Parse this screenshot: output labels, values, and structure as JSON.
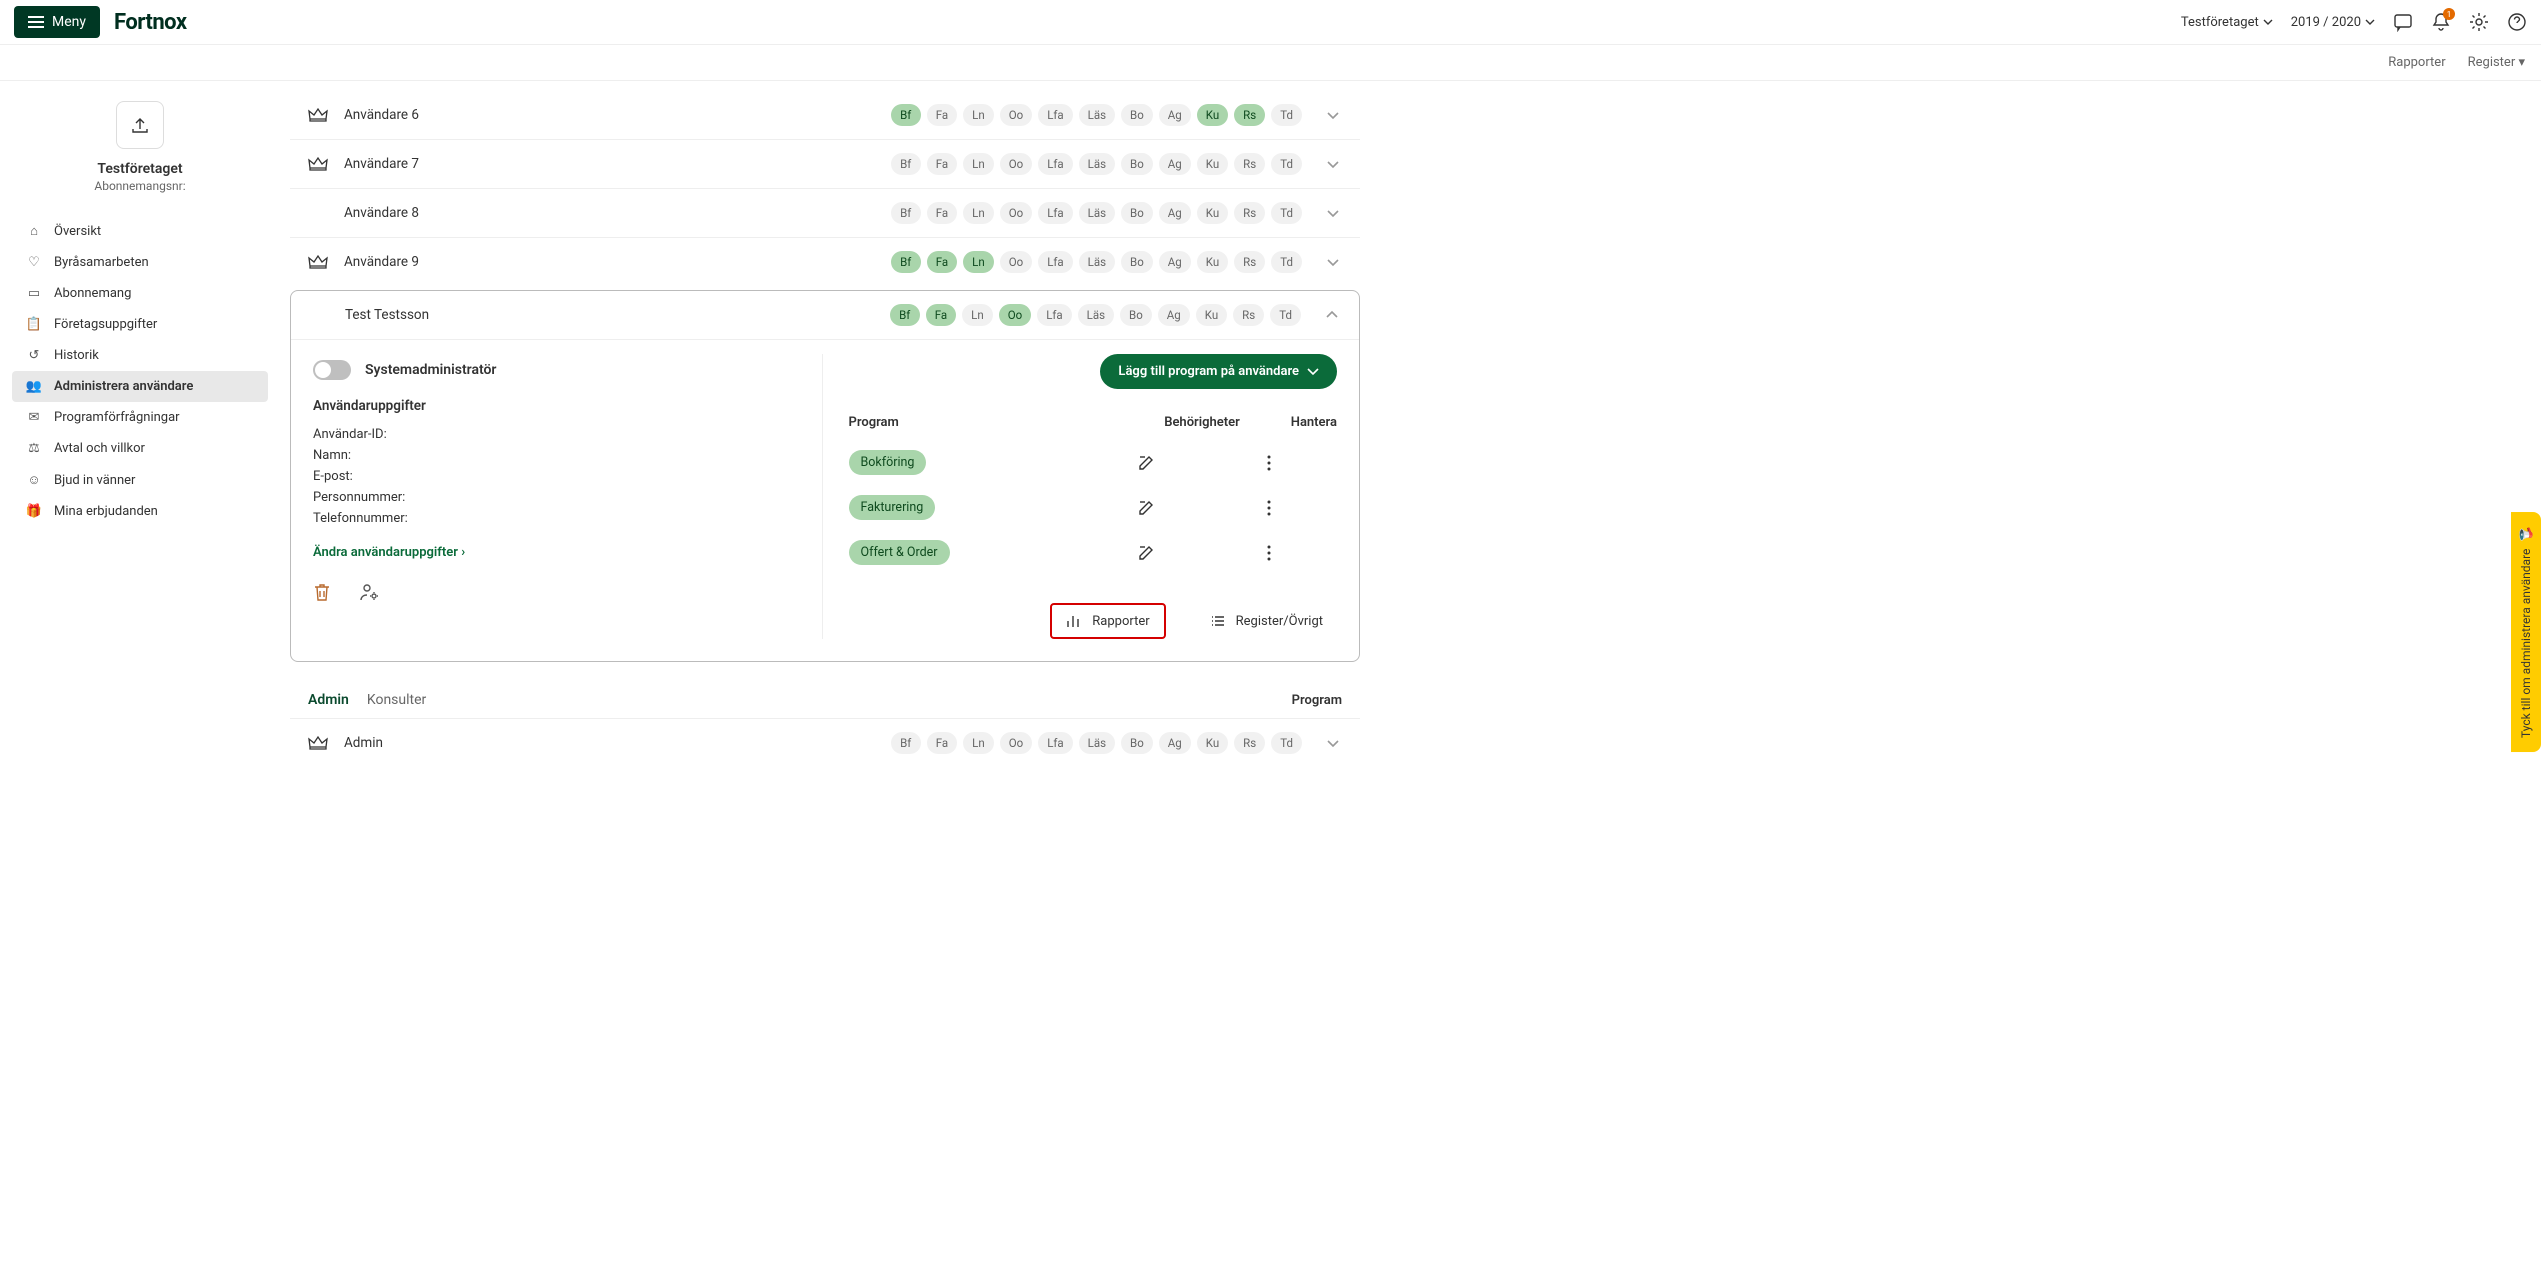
{
  "header": {
    "menu": "Meny",
    "logo": "Fortnox",
    "company": "Testföretaget",
    "fiscal": "2019 / 2020",
    "notif_count": "1"
  },
  "subheader": {
    "link1": "Rapporter",
    "link2": "Register"
  },
  "sidebar": {
    "company_name": "Testföretaget",
    "company_sub": "Abonnemangsnr:",
    "items": [
      {
        "label": "Översikt"
      },
      {
        "label": "Byråsamarbeten"
      },
      {
        "label": "Abonnemang"
      },
      {
        "label": "Företagsuppgifter"
      },
      {
        "label": "Historik"
      },
      {
        "label": "Administrera användare"
      },
      {
        "label": "Programförfrågningar"
      },
      {
        "label": "Avtal och villkor"
      },
      {
        "label": "Bjud in vänner"
      },
      {
        "label": "Mina erbjudanden"
      }
    ]
  },
  "badges_all": [
    "Bf",
    "Fa",
    "Ln",
    "Oo",
    "Lfa",
    "Läs",
    "Bo",
    "Ag",
    "Ku",
    "Rs",
    "Td"
  ],
  "users": [
    {
      "name": "Användare 6",
      "crown": true,
      "active_badges": [
        "Bf",
        "Ku",
        "Rs"
      ]
    },
    {
      "name": "Användare 7",
      "crown": true,
      "active_badges": []
    },
    {
      "name": "Användare 8",
      "crown": false,
      "active_badges": []
    },
    {
      "name": "Användare 9",
      "crown": true,
      "active_badges": [
        "Bf",
        "Fa",
        "Ln"
      ]
    }
  ],
  "expanded_user": {
    "name": "Test Testsson",
    "active_badges": [
      "Bf",
      "Fa",
      "Oo"
    ],
    "sysadmin_label": "Systemadministratör",
    "details_title": "Användaruppgifter",
    "fields": {
      "id": "Användar-ID:",
      "name": "Namn:",
      "email": "E-post:",
      "pnr": "Personnummer:",
      "phone": "Telefonnummer:"
    },
    "edit_link": "Ändra användaruppgifter ›",
    "add_program_btn": "Lägg till program på användare",
    "cols": {
      "program": "Program",
      "auth": "Behörigheter",
      "manage": "Hantera"
    },
    "programs": [
      "Bokföring",
      "Fakturering",
      "Offert & Order"
    ],
    "footer": {
      "reports": "Rapporter",
      "register": "Register/Övrigt"
    }
  },
  "tabs": {
    "admin": "Admin",
    "konsulter": "Konsulter",
    "right": "Program"
  },
  "admin_user": {
    "name": "Admin",
    "crown": true,
    "active_badges": []
  },
  "feedback": "Tyck till om administrera användare"
}
